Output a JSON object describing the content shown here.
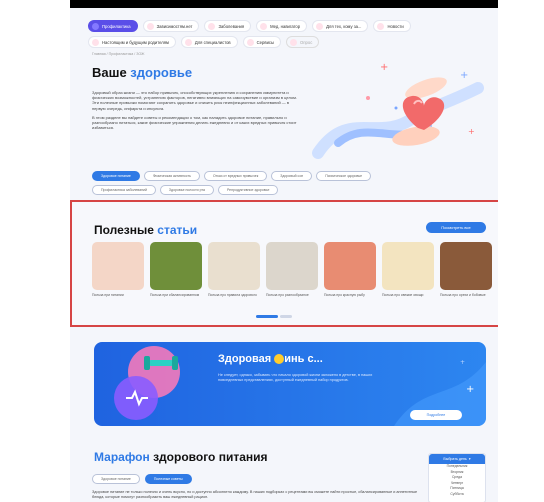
{
  "nav": {
    "items": [
      {
        "label": "Профилактика",
        "active": true
      },
      {
        "label": "Зависимостям.нет"
      },
      {
        "label": "Заболевания"
      },
      {
        "label": "Мед. навигатор"
      },
      {
        "label": "Для тех, кому за..."
      },
      {
        "label": "Новости"
      },
      {
        "label": "Настоящим и будущим родителям"
      },
      {
        "label": "Для специалистов"
      },
      {
        "label": "Сервисы"
      },
      {
        "label": "Опрос"
      }
    ]
  },
  "breadcrumb": "Главная  /  Профилактика  /  ЗОЖ",
  "hero": {
    "title_main": "Ваше ",
    "title_accent": "здоровье",
    "paragraphs": [
      "Здоровый образ жизни — это набор привычек, способствующих укреплению и сохранению иммунитета и физических возможностей, устранению факторов, негативно влияющих на самочувствие и организм в целом. Эти полезные привычки помогают сохранить здоровье и снизить риск неинфекционных заболеваний — в первую очередь, инфаркта и инсульта.",
      "В этом разделе вы найдете советы и рекомендации о том, как наладить здоровое питание, правильно и разнообразно питаться, какие физические упражнения делать ежедневно и от каких вредных привычек стоит избавиться."
    ]
  },
  "tags": [
    {
      "label": "Здоровое питание",
      "active": true
    },
    {
      "label": "Физическая активность"
    },
    {
      "label": "Отказ от вредных привычек"
    },
    {
      "label": "Здоровый сон"
    },
    {
      "label": "Психическое здоровье"
    },
    {
      "label": "Профилактика заболеваний"
    },
    {
      "label": "Здоровье полости рта"
    },
    {
      "label": "Репродуктивное здоровье"
    }
  ],
  "articles": {
    "title_main": "Полезные ",
    "title_accent": "статьи",
    "all_button": "Посмотреть все",
    "cards": [
      {
        "caption": "Польза при питании",
        "color": "#f4d6c7"
      },
      {
        "caption": "Польза при сбалансированном",
        "color": "#6f8f3a"
      },
      {
        "caption": "Польза про правила здорового",
        "color": "#e9dfcf"
      },
      {
        "caption": "Польза про разнообразное",
        "color": "#dcd6cc"
      },
      {
        "caption": "Польза про красную рыбу",
        "color": "#e88c72"
      },
      {
        "caption": "Польза про свежие овощи",
        "color": "#f3e4c0"
      },
      {
        "caption": "Польза про орехи и бобовые",
        "color": "#8a5a3a"
      }
    ]
  },
  "banner": {
    "title_before": "Здоровая ",
    "title_after": "инь с...",
    "text": "Не следует, однако, забывать что начало здоровой жизни заложено в детстве, в наших повседневных представлениях, доступный ежедневный набор продуктов.",
    "button": "Подробнее",
    "colors": {
      "bg": "#1f63e0",
      "accent": "#ffcc2e"
    }
  },
  "marathon": {
    "title_accent": "Марафон",
    "title_main": " здорового питания",
    "tags": [
      {
        "label": "Здоровое питание"
      },
      {
        "label": "Полезные советы",
        "active": true
      }
    ],
    "text": "Здоровое питание не только полезно и очень вкусно, но и доступно абсолютно каждому. В наших подборках с рецептами вы сможете найти простые, сбалансированные и аппетитные блюда, которые помогут разнообразить ваш ежедневный рацион.",
    "dropdown": {
      "selected": "Выбрать день",
      "options": [
        "Понедельник",
        "Вторник",
        "Среда",
        "Четверг",
        "Пятница",
        "Суббота"
      ]
    }
  }
}
